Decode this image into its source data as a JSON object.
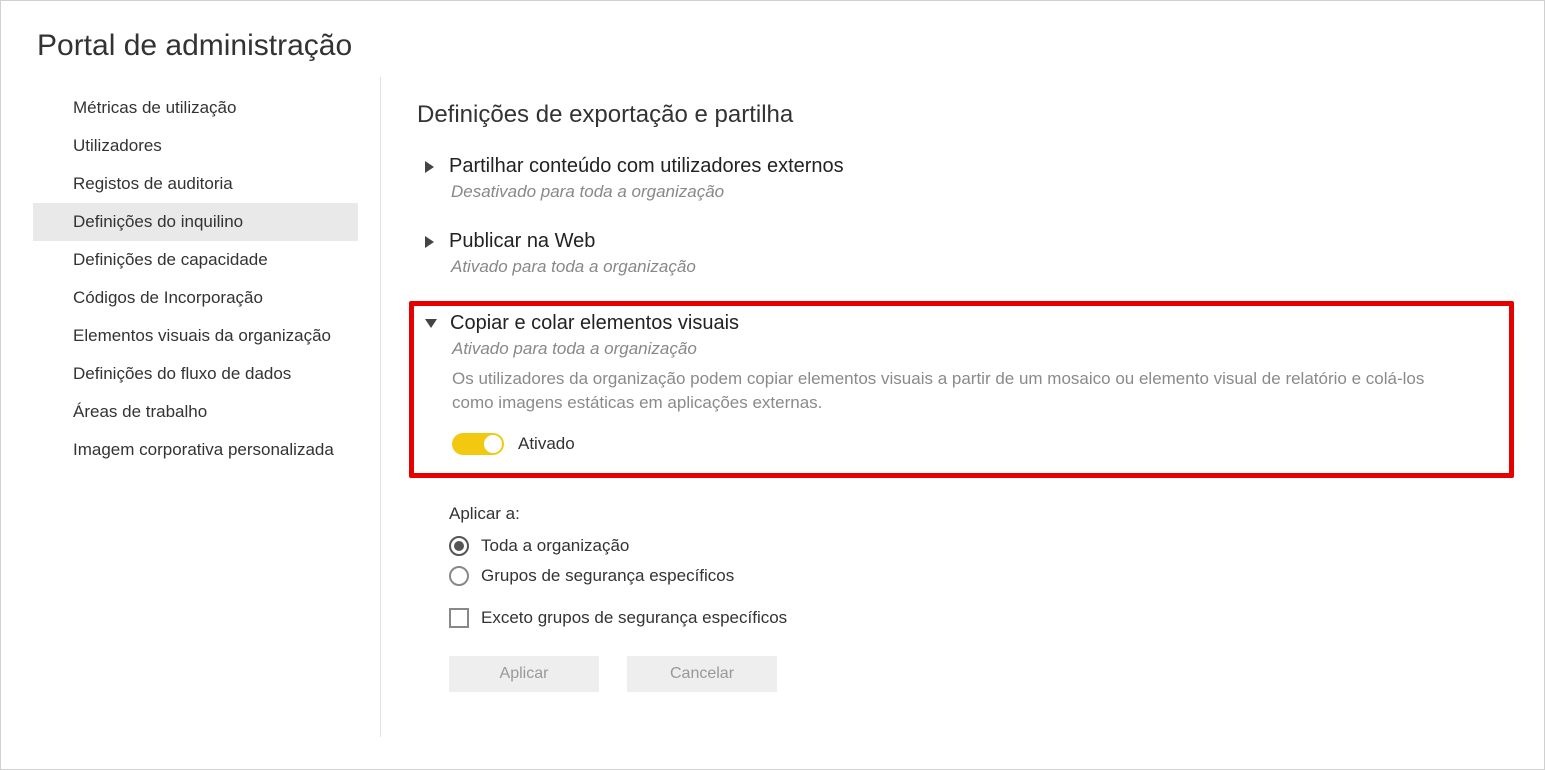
{
  "page_title": "Portal de administração",
  "sidebar": {
    "items": [
      {
        "label": "Métricas de utilização",
        "active": false
      },
      {
        "label": "Utilizadores",
        "active": false
      },
      {
        "label": "Registos de auditoria",
        "active": false
      },
      {
        "label": "Definições do inquilino",
        "active": true
      },
      {
        "label": "Definições de capacidade",
        "active": false
      },
      {
        "label": "Códigos de Incorporação",
        "active": false
      },
      {
        "label": "Elementos visuais da organização",
        "active": false
      },
      {
        "label": "Definições do fluxo de dados",
        "active": false
      },
      {
        "label": "Áreas de trabalho",
        "active": false
      },
      {
        "label": "Imagem corporativa personalizada",
        "active": false
      }
    ]
  },
  "content": {
    "section_heading": "Definições de exportação e partilha",
    "settings": [
      {
        "expanded": false,
        "title": "Partilhar conteúdo com utilizadores externos",
        "status": "Desativado para toda a organização"
      },
      {
        "expanded": false,
        "title": "Publicar na Web",
        "status": "Ativado para toda a organização"
      },
      {
        "expanded": true,
        "highlight": true,
        "title": "Copiar e colar elementos visuais",
        "status": "Ativado para toda a organização",
        "description": "Os utilizadores da organização podem copiar elementos visuais a partir de um mosaico ou elemento visual de relatório e colá-los como imagens estáticas em aplicações externas.",
        "toggle_on": true,
        "toggle_label": "Ativado"
      }
    ],
    "apply": {
      "heading": "Aplicar a:",
      "options": [
        {
          "label": "Toda a organização",
          "checked": true
        },
        {
          "label": "Grupos de segurança específicos",
          "checked": false
        }
      ],
      "exclude": {
        "label": "Exceto grupos de segurança específicos",
        "checked": false
      }
    },
    "buttons": {
      "apply": "Aplicar",
      "cancel": "Cancelar"
    }
  }
}
